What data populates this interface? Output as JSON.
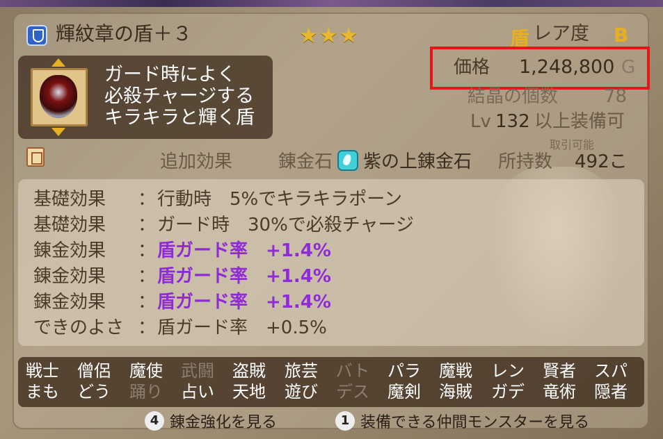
{
  "item": {
    "name": "輝紋章の盾＋３",
    "stars": "★★★",
    "shield_kanji": "盾",
    "rarity_label": "レア度",
    "rarity_value": "B",
    "description": [
      "ガード時によく",
      "必殺チャージする",
      "キラキラと輝く盾"
    ]
  },
  "stats": {
    "price_label": "価格",
    "price_value": "1,248,800",
    "price_unit": "G",
    "crystal_label": "結晶の個数",
    "crystal_value": "78",
    "level_label": "Lv",
    "level_value": "132",
    "level_suffix": "以上装備可",
    "trade_note": "取引可能"
  },
  "alchemy": {
    "extra_effect_label": "追加効果",
    "stone_label": "錬金石",
    "stone_name": "紫の上錬金石",
    "owned_label": "所持数",
    "owned_value": "492こ"
  },
  "effects": [
    {
      "label": "基礎効果",
      "value": "行動時　5%でキラキラポーン",
      "highlight": false
    },
    {
      "label": "基礎効果",
      "value": "ガード時　30%で必殺チャージ",
      "highlight": false
    },
    {
      "label": "錬金効果",
      "value": "盾ガード率　+1.4%",
      "highlight": true
    },
    {
      "label": "錬金効果",
      "value": "盾ガード率　+1.4%",
      "highlight": true
    },
    {
      "label": "錬金効果",
      "value": "盾ガード率　+1.4%",
      "highlight": true
    },
    {
      "label": "できのよさ",
      "value": "盾ガード率　+0.5%",
      "highlight": false
    }
  ],
  "jobs": [
    {
      "top": "戦士",
      "bottom": "まも",
      "top_dim": false,
      "bottom_dim": false
    },
    {
      "top": "僧侶",
      "bottom": "どう",
      "top_dim": false,
      "bottom_dim": false
    },
    {
      "top": "魔使",
      "bottom": "踊り",
      "top_dim": false,
      "bottom_dim": true
    },
    {
      "top": "武闘",
      "bottom": "占い",
      "top_dim": true,
      "bottom_dim": false
    },
    {
      "top": "盗賊",
      "bottom": "天地",
      "top_dim": false,
      "bottom_dim": false
    },
    {
      "top": "旅芸",
      "bottom": "遊び",
      "top_dim": false,
      "bottom_dim": false
    },
    {
      "top": "バト",
      "bottom": "デス",
      "top_dim": true,
      "bottom_dim": true
    },
    {
      "top": "パラ",
      "bottom": "魔剣",
      "top_dim": false,
      "bottom_dim": false
    },
    {
      "top": "魔戦",
      "bottom": "海賊",
      "top_dim": false,
      "bottom_dim": false
    },
    {
      "top": "レン",
      "bottom": "ガデ",
      "top_dim": false,
      "bottom_dim": false
    },
    {
      "top": "賢者",
      "bottom": "竜術",
      "top_dim": false,
      "bottom_dim": false
    },
    {
      "top": "スパ",
      "bottom": "隠者",
      "top_dim": false,
      "bottom_dim": false
    }
  ],
  "actions": [
    {
      "key": "4",
      "label": "錬金強化を見る"
    },
    {
      "key": "1",
      "label": "装備できる仲間モンスターを見る"
    }
  ],
  "colors": {
    "highlight": "#8f2bd6",
    "price_box": "#e01818",
    "accent": "#e8b020"
  }
}
